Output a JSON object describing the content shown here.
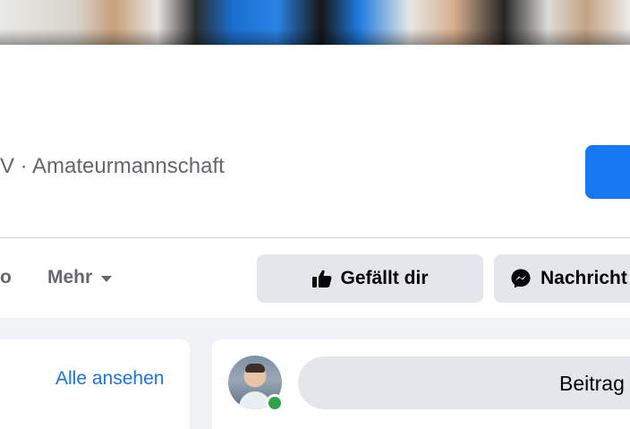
{
  "page": {
    "category_line": "V · Amateurmannschaft"
  },
  "nav": {
    "prev_tab_fragment": "o",
    "more_label": "Mehr"
  },
  "actions": {
    "like_label": "Gefällt dir",
    "message_label": "Nachricht"
  },
  "photos_card": {
    "see_all_label": "Alle ansehen"
  },
  "composer": {
    "placeholder_fragment": "Beitrag"
  },
  "colors": {
    "brand_blue": "#1877f2",
    "link_blue": "#1b74e4",
    "online_green": "#31a24c"
  }
}
